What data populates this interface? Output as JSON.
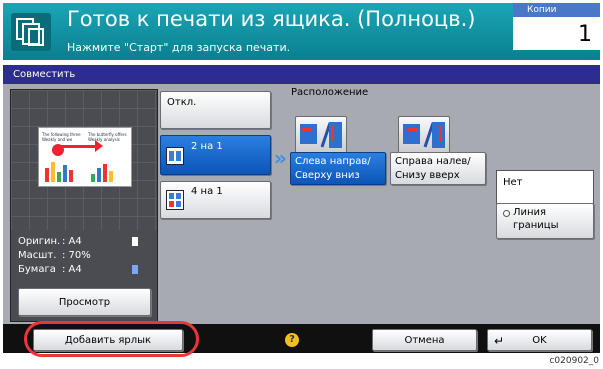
{
  "header": {
    "title": "Готов к печати из ящика. (Полноцв.)",
    "subtitle": "Нажмите \"Старт\" для запуска печати.",
    "copies_label": "Копии",
    "copies_value": "1"
  },
  "tab": {
    "label": "Совместить"
  },
  "preview": {
    "thumb_left_text": "The following three Weakly and we",
    "thumb_right_text": "The butterfly offers Weakly analysis",
    "info": [
      {
        "key": "Оригин.",
        "value": ": A4"
      },
      {
        "key": "Масшт.",
        "value": ": 70%"
      },
      {
        "key": "Бумага",
        "value": ": A4"
      }
    ],
    "button": "Просмотр"
  },
  "modes": {
    "off": "Откл.",
    "two_in_one": "2 на 1",
    "four_in_one": "4 на 1",
    "selected": "2 на 1"
  },
  "layout": {
    "label": "Расположение",
    "option1": "Слева направ/ Сверху вниз",
    "option2": "Справа налев/ Снизу вверх",
    "selected": "Слева направ/ Сверху вниз"
  },
  "border": {
    "value": "Нет",
    "button": "Линия границы"
  },
  "bottom": {
    "add_shortcut": "Добавить ярлык",
    "help": "?",
    "cancel": "Отмена",
    "ok": "OK"
  },
  "caption": "c020902_0",
  "colors": {
    "header": "#0a8a9a",
    "tab": "#2c2d8e",
    "selected": "#0b56b8",
    "highlight": "#e8363b"
  }
}
